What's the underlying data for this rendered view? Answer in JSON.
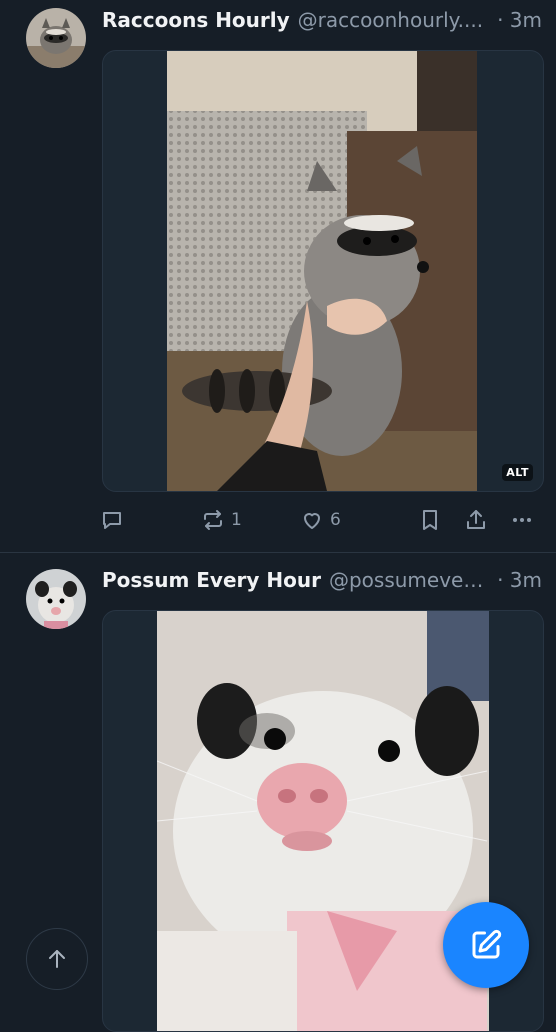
{
  "posts": [
    {
      "display_name": "Raccoons Hourly",
      "handle": "@raccoonhourly....",
      "time": "· 3m",
      "media": {
        "alt_badge": "ALT"
      },
      "actions": {
        "reply_count": "",
        "repost_count": "1",
        "like_count": "6"
      }
    },
    {
      "display_name": "Possum Every Hour",
      "handle": "@possumevery...",
      "time": "· 3m"
    }
  ],
  "icons": {
    "reply": "reply-icon",
    "repost": "repost-icon",
    "like": "heart-icon",
    "bookmark": "bookmark-icon",
    "share": "share-icon",
    "more": "more-icon",
    "scroll_top": "arrow-up-icon",
    "compose": "compose-icon"
  },
  "colors": {
    "background": "#161e27",
    "text_primary": "#f1f3f5",
    "text_secondary": "#8d9aa9",
    "accent": "#1a85ff"
  }
}
